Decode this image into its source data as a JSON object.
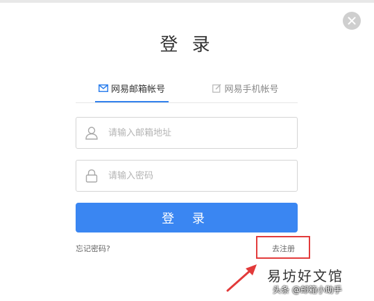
{
  "dialog": {
    "title": "登 录"
  },
  "tabs": [
    {
      "label": "网易邮箱帐号",
      "active": true,
      "icon": "envelope-icon"
    },
    {
      "label": "网易手机帐号",
      "active": false,
      "icon": "edit-icon"
    }
  ],
  "form": {
    "email_placeholder": "请输入邮箱地址",
    "password_placeholder": "请输入密码",
    "login_label": "登 录",
    "forgot_label": "忘记密码?",
    "register_label": "去注册"
  },
  "watermark": {
    "top": "易坊好文馆",
    "bottom": "头条 @邮箱小助手"
  },
  "colors": {
    "accent": "#3a86f2",
    "highlight": "#e23a3a"
  }
}
